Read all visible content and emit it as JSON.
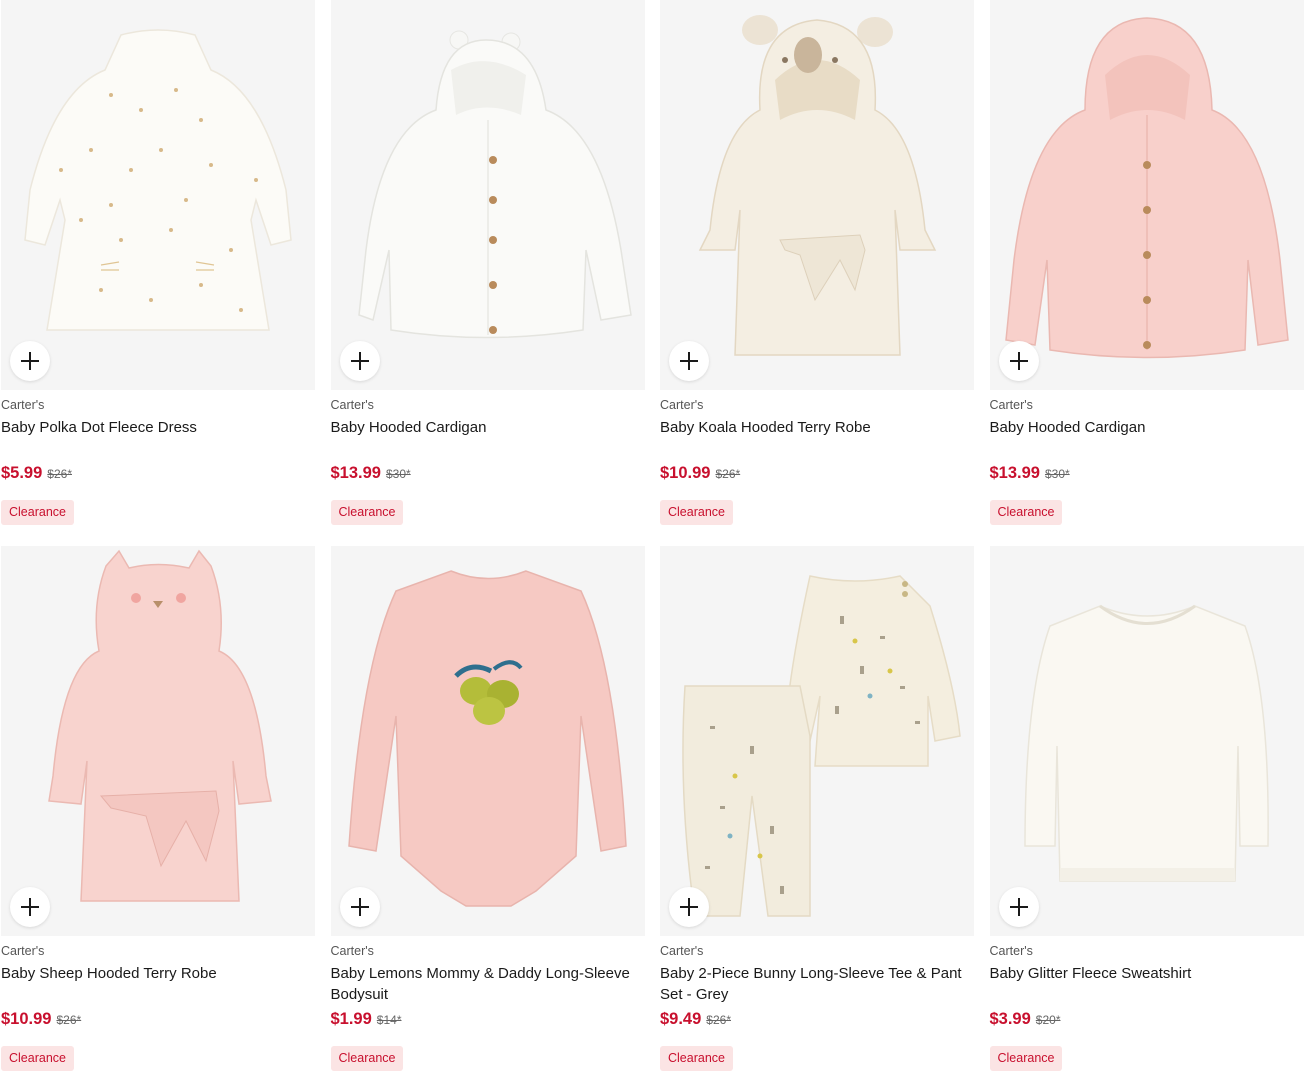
{
  "colors": {
    "price_red": "#c8102e",
    "badge_bg": "#fbe4e4",
    "image_bg": "#f5f5f5"
  },
  "products": [
    {
      "brand": "Carter's",
      "name": "Baby Polka Dot Fleece Dress",
      "price": "$5.99",
      "original_price": "$26*",
      "badge": "Clearance",
      "add_icon": "plus-icon"
    },
    {
      "brand": "Carter's",
      "name": "Baby Hooded Cardigan",
      "price": "$13.99",
      "original_price": "$30*",
      "badge": "Clearance",
      "add_icon": "plus-icon"
    },
    {
      "brand": "Carter's",
      "name": "Baby Koala Hooded Terry Robe",
      "price": "$10.99",
      "original_price": "$26*",
      "badge": "Clearance",
      "add_icon": "plus-icon"
    },
    {
      "brand": "Carter's",
      "name": "Baby Hooded Cardigan",
      "price": "$13.99",
      "original_price": "$30*",
      "badge": "Clearance",
      "add_icon": "plus-icon"
    },
    {
      "brand": "Carter's",
      "name": "Baby Sheep Hooded Terry Robe",
      "price": "$10.99",
      "original_price": "$26*",
      "badge": "Clearance",
      "add_icon": "plus-icon"
    },
    {
      "brand": "Carter's",
      "name": "Baby Lemons Mommy & Daddy Long-Sleeve Bodysuit",
      "price": "$1.99",
      "original_price": "$14*",
      "badge": "Clearance",
      "add_icon": "plus-icon"
    },
    {
      "brand": "Carter's",
      "name": "Baby 2-Piece Bunny Long-Sleeve Tee & Pant Set - Grey",
      "price": "$9.49",
      "original_price": "$26*",
      "badge": "Clearance",
      "add_icon": "plus-icon"
    },
    {
      "brand": "Carter's",
      "name": "Baby Glitter Fleece Sweatshirt",
      "price": "$3.99",
      "original_price": "$20*",
      "badge": "Clearance",
      "add_icon": "plus-icon"
    }
  ]
}
